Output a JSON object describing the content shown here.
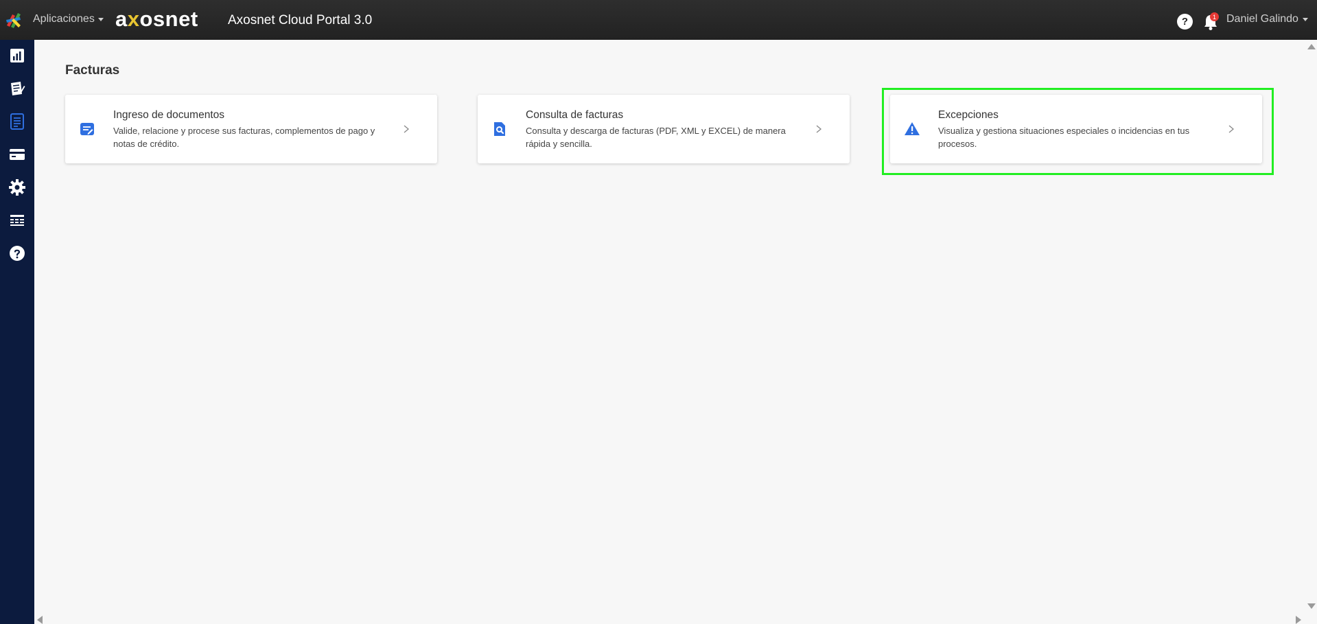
{
  "header": {
    "apps_menu_label": "Aplicaciones",
    "brand_prefix": "a",
    "brand_mark": "x",
    "brand_suffix": "osnet",
    "portal_title": "Axosnet Cloud Portal 3.0",
    "help_label": "?",
    "notification_count": "1",
    "user_name": "Daniel Galindo",
    "icons": {
      "app_logo": "apps-logo-icon",
      "help": "question-icon",
      "notifications": "bell-icon"
    }
  },
  "sidebar": {
    "items": [
      {
        "name": "dashboard",
        "icon": "bar-chart-icon"
      },
      {
        "name": "documents",
        "icon": "document-edit-icon"
      },
      {
        "name": "invoices",
        "icon": "invoice-list-icon",
        "active": true
      },
      {
        "name": "payments",
        "icon": "credit-card-icon"
      },
      {
        "name": "settings",
        "icon": "gear-icon"
      },
      {
        "name": "tables",
        "icon": "table-icon"
      },
      {
        "name": "help",
        "icon": "question-circle-icon"
      }
    ]
  },
  "main": {
    "title": "Facturas",
    "cards": [
      {
        "title": "Ingreso de documentos",
        "description": "Valide, relacione y procese sus facturas, complementos de pago y notas de crédito.",
        "icon": "document-edit-icon"
      },
      {
        "title": "Consulta de facturas",
        "description": "Consulta y descarga de facturas (PDF, XML y EXCEL) de manera rápida y sencilla.",
        "icon": "document-search-icon"
      },
      {
        "title": "Excepciones",
        "description": "Visualiza y gestiona situaciones especiales o incidencias en tus procesos.",
        "icon": "warning-icon",
        "highlighted": true
      }
    ]
  },
  "colors": {
    "topbar": "#262626",
    "sidebar": "#0c1b3e",
    "accent_blue": "#2f6fe0",
    "highlight": "#22ee22",
    "background": "#f7f7f7"
  }
}
